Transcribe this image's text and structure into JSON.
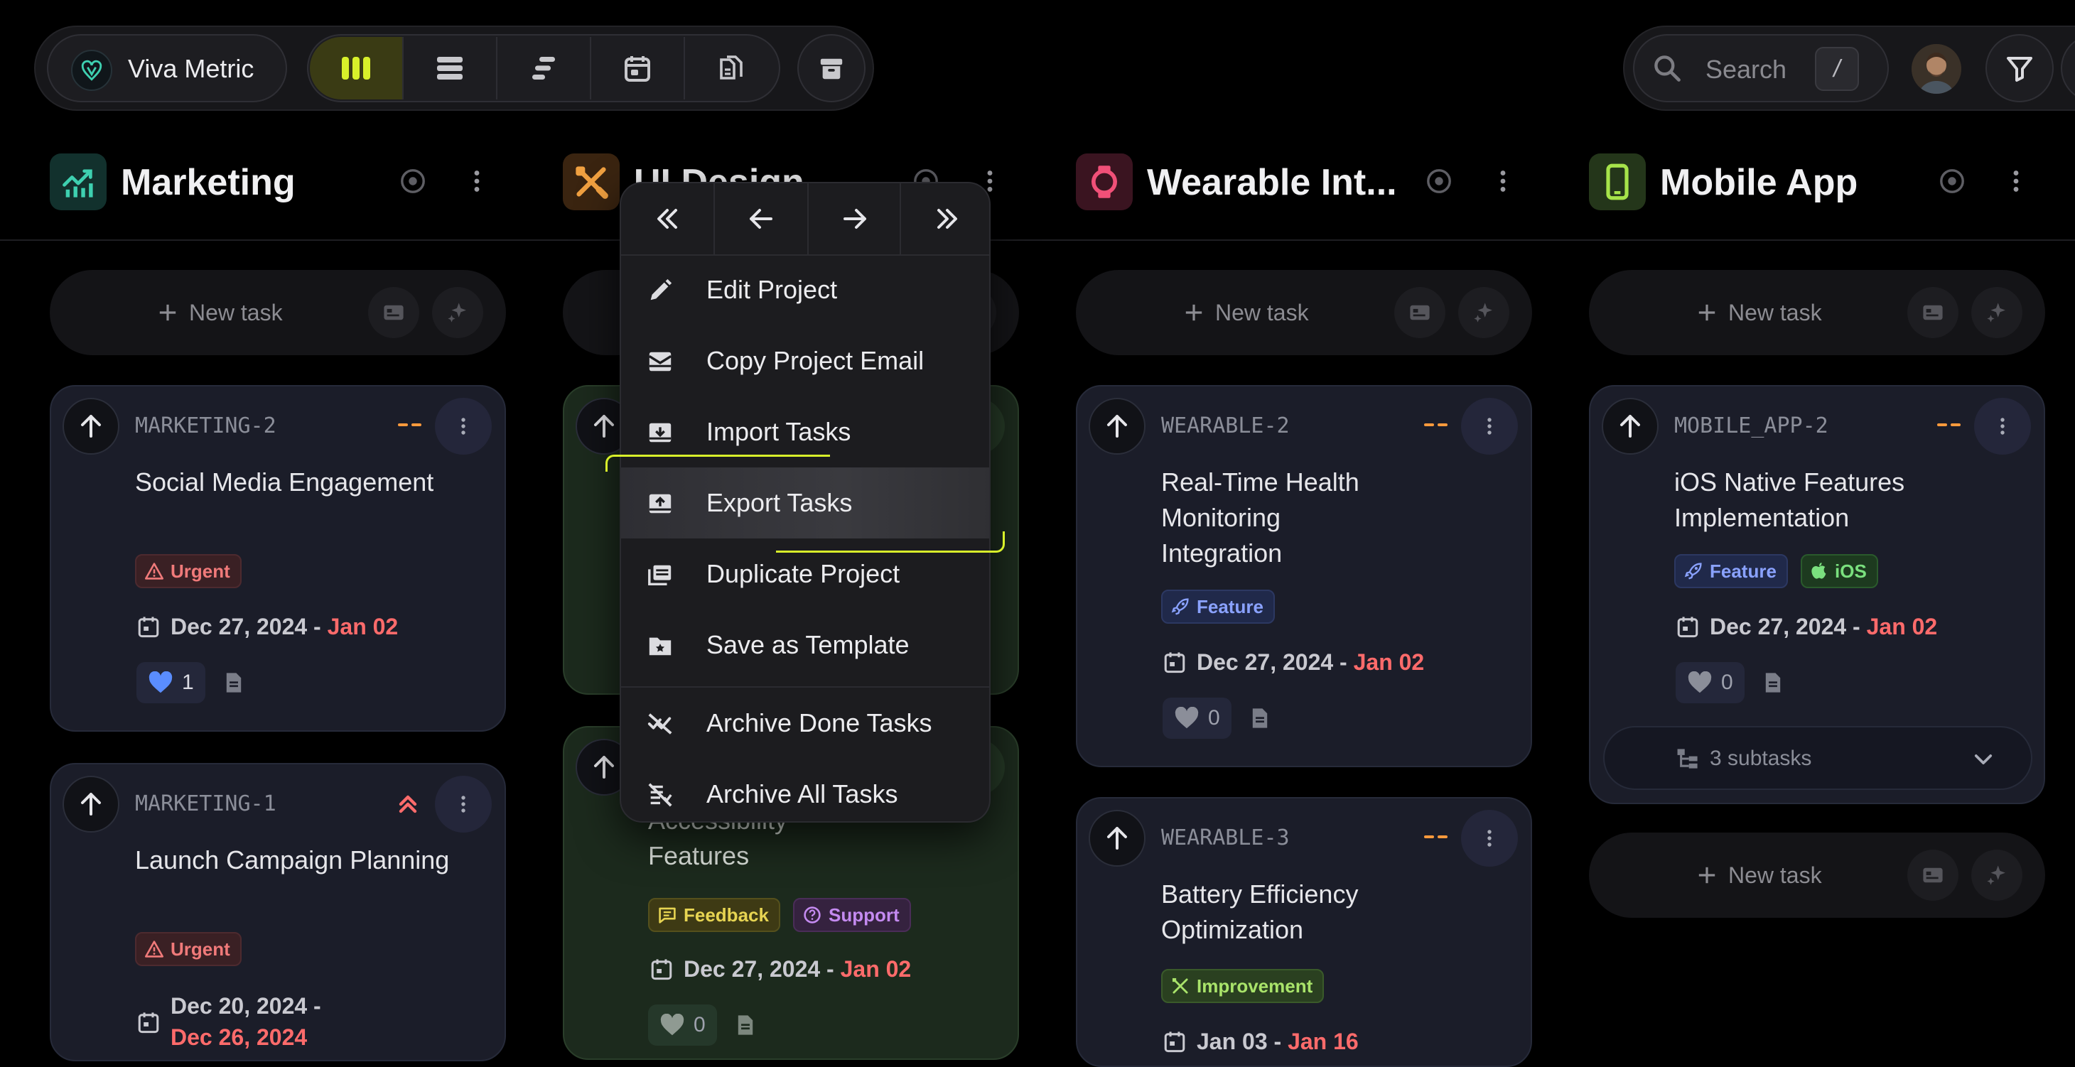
{
  "app": {
    "brand_name": "Viva Metric",
    "accent": "#d8f02a"
  },
  "toolbar": {
    "views": [
      {
        "icon": "board-view-icon",
        "active": true
      },
      {
        "icon": "list-view-icon",
        "active": false
      },
      {
        "icon": "timeline-view-icon",
        "active": false
      },
      {
        "icon": "calendar-view-icon",
        "active": false
      },
      {
        "icon": "docs-view-icon",
        "active": false
      }
    ],
    "archive_icon": "archive-icon",
    "search_placeholder": "Search",
    "search_shortcut": "/",
    "filter_icon": "filter-icon"
  },
  "columns": [
    {
      "title": "Marketing",
      "icon": "chart-icon",
      "icon_color": "#3ed0b0",
      "new_task_label": "New task",
      "cards": [
        {
          "code": "MARKETING-2",
          "priority": "medium",
          "title": "Social Media Engagement",
          "tags": [
            {
              "label": "Urgent",
              "kind": "urgent"
            }
          ],
          "date_start": "Dec 27, 2024 - ",
          "date_end": "Jan 02",
          "likes": "1"
        },
        {
          "code": "MARKETING-1",
          "priority": "high",
          "title": "Launch Campaign Planning",
          "tags": [
            {
              "label": "Urgent",
              "kind": "urgent"
            }
          ],
          "date_start": "Dec 20, 2024 -",
          "date_end": "Dec 26, 2024"
        }
      ]
    },
    {
      "title": "UI Design",
      "icon": "design-tools-icon",
      "icon_color": "#f0a040",
      "cards": [
        {
          "title_partial": "Accessibility Features",
          "tags": [
            {
              "label": "Feedback",
              "kind": "feedback"
            },
            {
              "label": "Support",
              "kind": "support"
            }
          ],
          "date_start": "Dec 27, 2024 - ",
          "date_end": "Jan 02",
          "likes": "0"
        }
      ]
    },
    {
      "title": "Wearable Int...",
      "icon": "watch-icon",
      "icon_color": "#f05078",
      "new_task_label": "New task",
      "cards": [
        {
          "code": "WEARABLE-2",
          "priority": "medium",
          "title": "Real-Time Health Monitoring Integration",
          "tags": [
            {
              "label": "Feature",
              "kind": "feature"
            }
          ],
          "date_start": "Dec 27, 2024 - ",
          "date_end": "Jan 02",
          "likes": "0"
        },
        {
          "code": "WEARABLE-3",
          "priority": "medium",
          "title": "Battery Efficiency Optimization",
          "tags": [
            {
              "label": "Improvement",
              "kind": "improve"
            }
          ],
          "date_start": "Jan 03 - ",
          "date_end": "Jan 16"
        }
      ]
    },
    {
      "title": "Mobile App",
      "icon": "phone-icon",
      "icon_color": "#a6e34a",
      "new_task_label": "New task",
      "cards": [
        {
          "code": "MOBILE_APP-2",
          "priority": "medium",
          "title": "iOS Native Features Implementation",
          "tags": [
            {
              "label": "Feature",
              "kind": "feature"
            },
            {
              "label": "iOS",
              "kind": "ios"
            }
          ],
          "date_start": "Dec 27, 2024 - ",
          "date_end": "Jan 02",
          "likes": "0",
          "subtasks": "3 subtasks"
        }
      ],
      "new_task_label_bottom": "New task"
    }
  ],
  "context_menu": {
    "nav": [
      "move-first-icon",
      "move-left-icon",
      "move-right-icon",
      "move-last-icon"
    ],
    "items": [
      {
        "label": "Edit Project",
        "icon": "pencil-icon"
      },
      {
        "label": "Copy Project Email",
        "icon": "mail-icon"
      },
      {
        "label": "Import Tasks",
        "icon": "import-icon"
      },
      {
        "label": "Export Tasks",
        "icon": "export-icon",
        "hovered": true
      },
      {
        "label": "Duplicate Project",
        "icon": "duplicate-icon"
      },
      {
        "label": "Save as Template",
        "icon": "template-icon"
      },
      {
        "label": "Archive Done Tasks",
        "icon": "archive-done-icon"
      },
      {
        "label": "Archive All Tasks",
        "icon": "archive-all-icon"
      }
    ]
  }
}
